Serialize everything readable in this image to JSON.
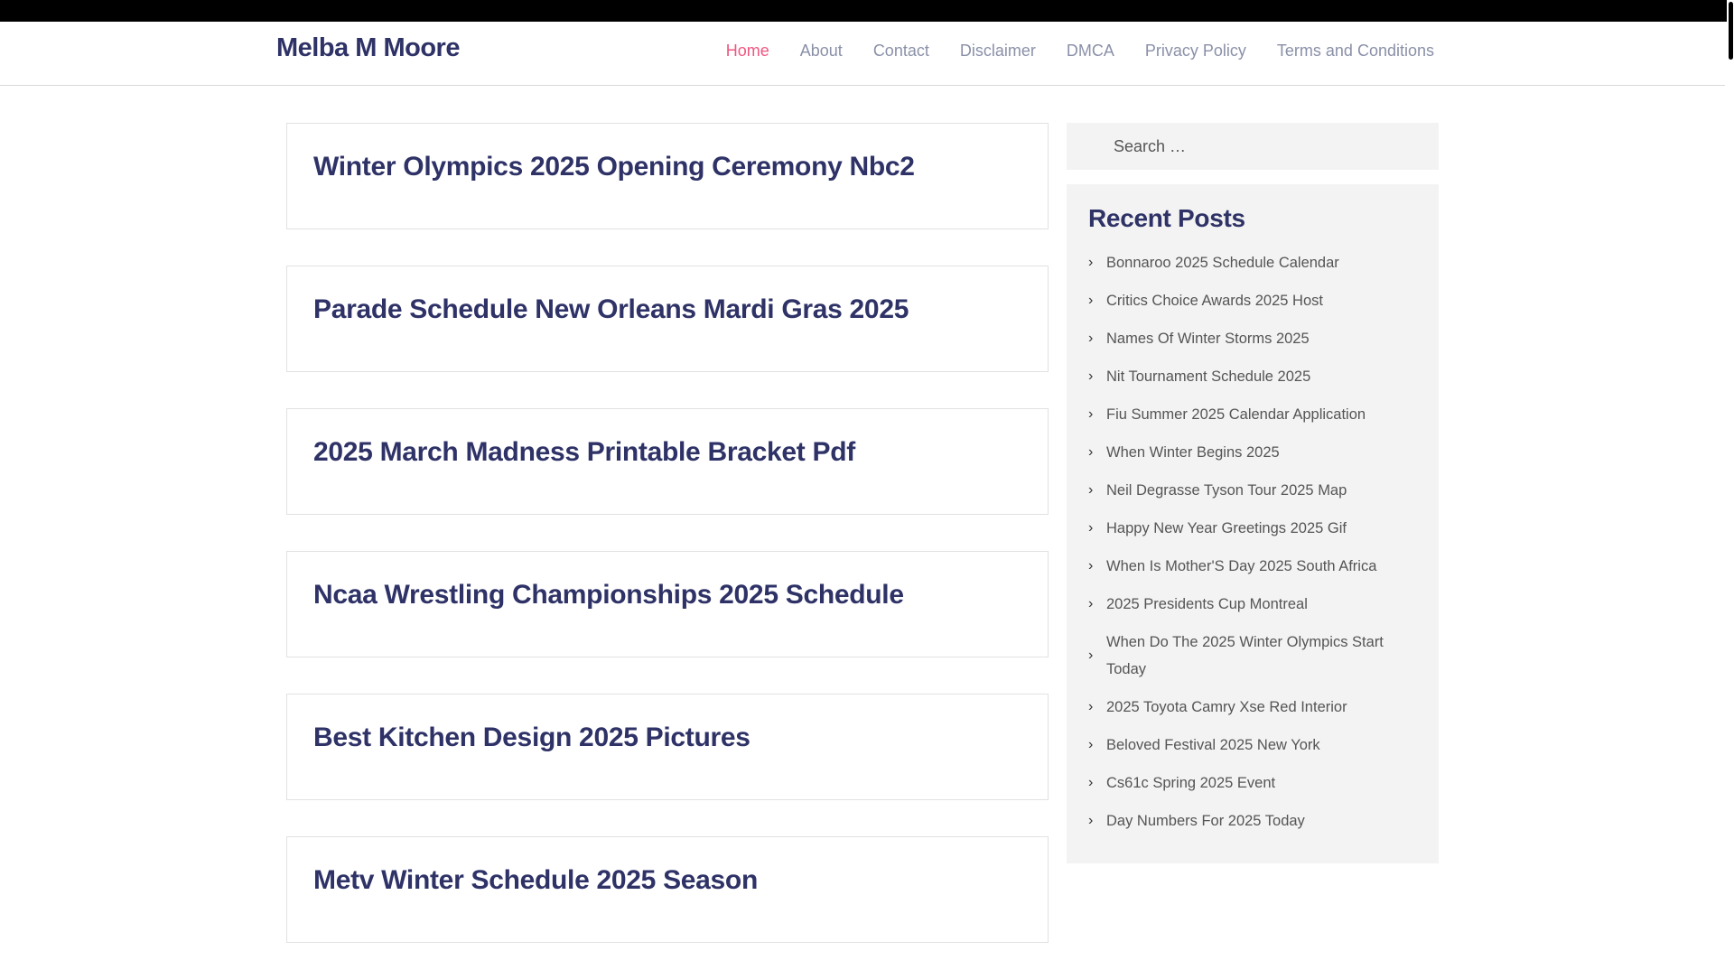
{
  "site": {
    "title": "Melba M Moore"
  },
  "nav": {
    "items": [
      {
        "label": "Home",
        "active": true
      },
      {
        "label": "About"
      },
      {
        "label": "Contact"
      },
      {
        "label": "Disclaimer"
      },
      {
        "label": "DMCA"
      },
      {
        "label": "Privacy Policy"
      },
      {
        "label": "Terms and Conditions"
      }
    ]
  },
  "posts": [
    {
      "title": "Winter Olympics 2025 Opening Ceremony Nbc2"
    },
    {
      "title": "Parade Schedule New Orleans Mardi Gras 2025"
    },
    {
      "title": "2025 March Madness Printable Bracket Pdf"
    },
    {
      "title": "Ncaa Wrestling Championships 2025 Schedule"
    },
    {
      "title": "Best Kitchen Design 2025 Pictures"
    },
    {
      "title": "Metv Winter Schedule 2025 Season"
    }
  ],
  "sidebar": {
    "search": {
      "placeholder": "Search …"
    },
    "recent_posts": {
      "title": "Recent Posts",
      "items": [
        "Bonnaroo 2025 Schedule Calendar",
        "Critics Choice Awards 2025 Host",
        "Names Of Winter Storms 2025",
        "Nit Tournament Schedule 2025",
        "Fiu Summer 2025 Calendar Application",
        "When Winter Begins 2025",
        "Neil Degrasse Tyson Tour 2025 Map",
        "Happy New Year Greetings 2025 Gif",
        "When Is Mother'S Day 2025 South Africa",
        "2025 Presidents Cup Montreal",
        "When Do The 2025 Winter Olympics Start Today",
        "2025 Toyota Camry Xse Red Interior",
        "Beloved Festival 2025 New York",
        "Cs61c Spring 2025 Event",
        "Day Numbers For 2025 Today"
      ]
    }
  },
  "colors": {
    "title": "#2e3266",
    "nav_active": "#f0567f",
    "nav": "#8a90a8"
  },
  "icons": {
    "list_bullet": "chevron-right-icon"
  }
}
